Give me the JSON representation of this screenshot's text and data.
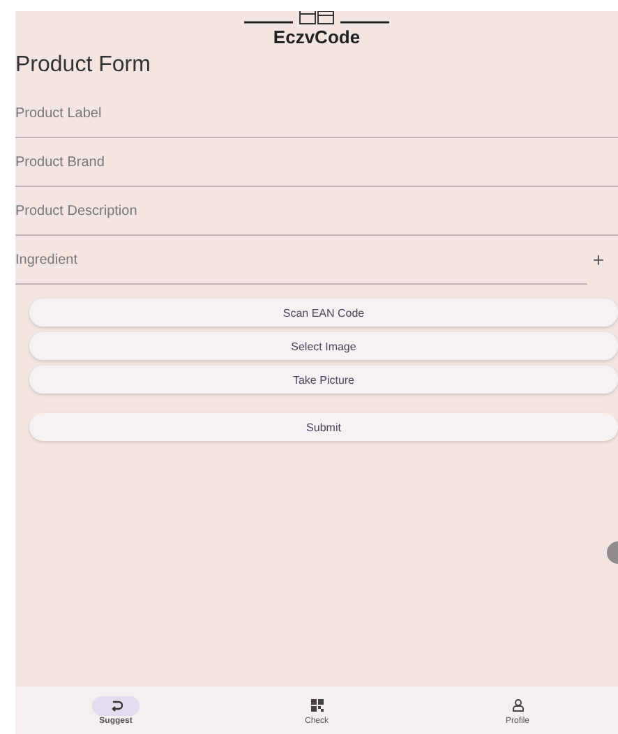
{
  "header": {
    "logo_text": "EczvCode",
    "title": "Product Form"
  },
  "fields": [
    {
      "placeholder": "Product Label",
      "kind": "text"
    },
    {
      "placeholder": "Product Brand",
      "kind": "text"
    },
    {
      "placeholder": "Product Description",
      "kind": "text"
    },
    {
      "placeholder": "Ingredient",
      "kind": "add",
      "add_symbol": "+"
    }
  ],
  "buttons": [
    {
      "label": "Scan EAN Code",
      "kind": "action"
    },
    {
      "label": "Select Image",
      "kind": "action"
    },
    {
      "label": "Take Picture",
      "kind": "action"
    },
    {
      "label": "Submit",
      "kind": "submit"
    }
  ],
  "nav": [
    {
      "label": "Suggest",
      "kind": "suggest",
      "selected": true
    },
    {
      "label": "Check",
      "kind": "qr",
      "selected": false
    },
    {
      "label": "Profile",
      "kind": "person",
      "selected": false
    }
  ]
}
